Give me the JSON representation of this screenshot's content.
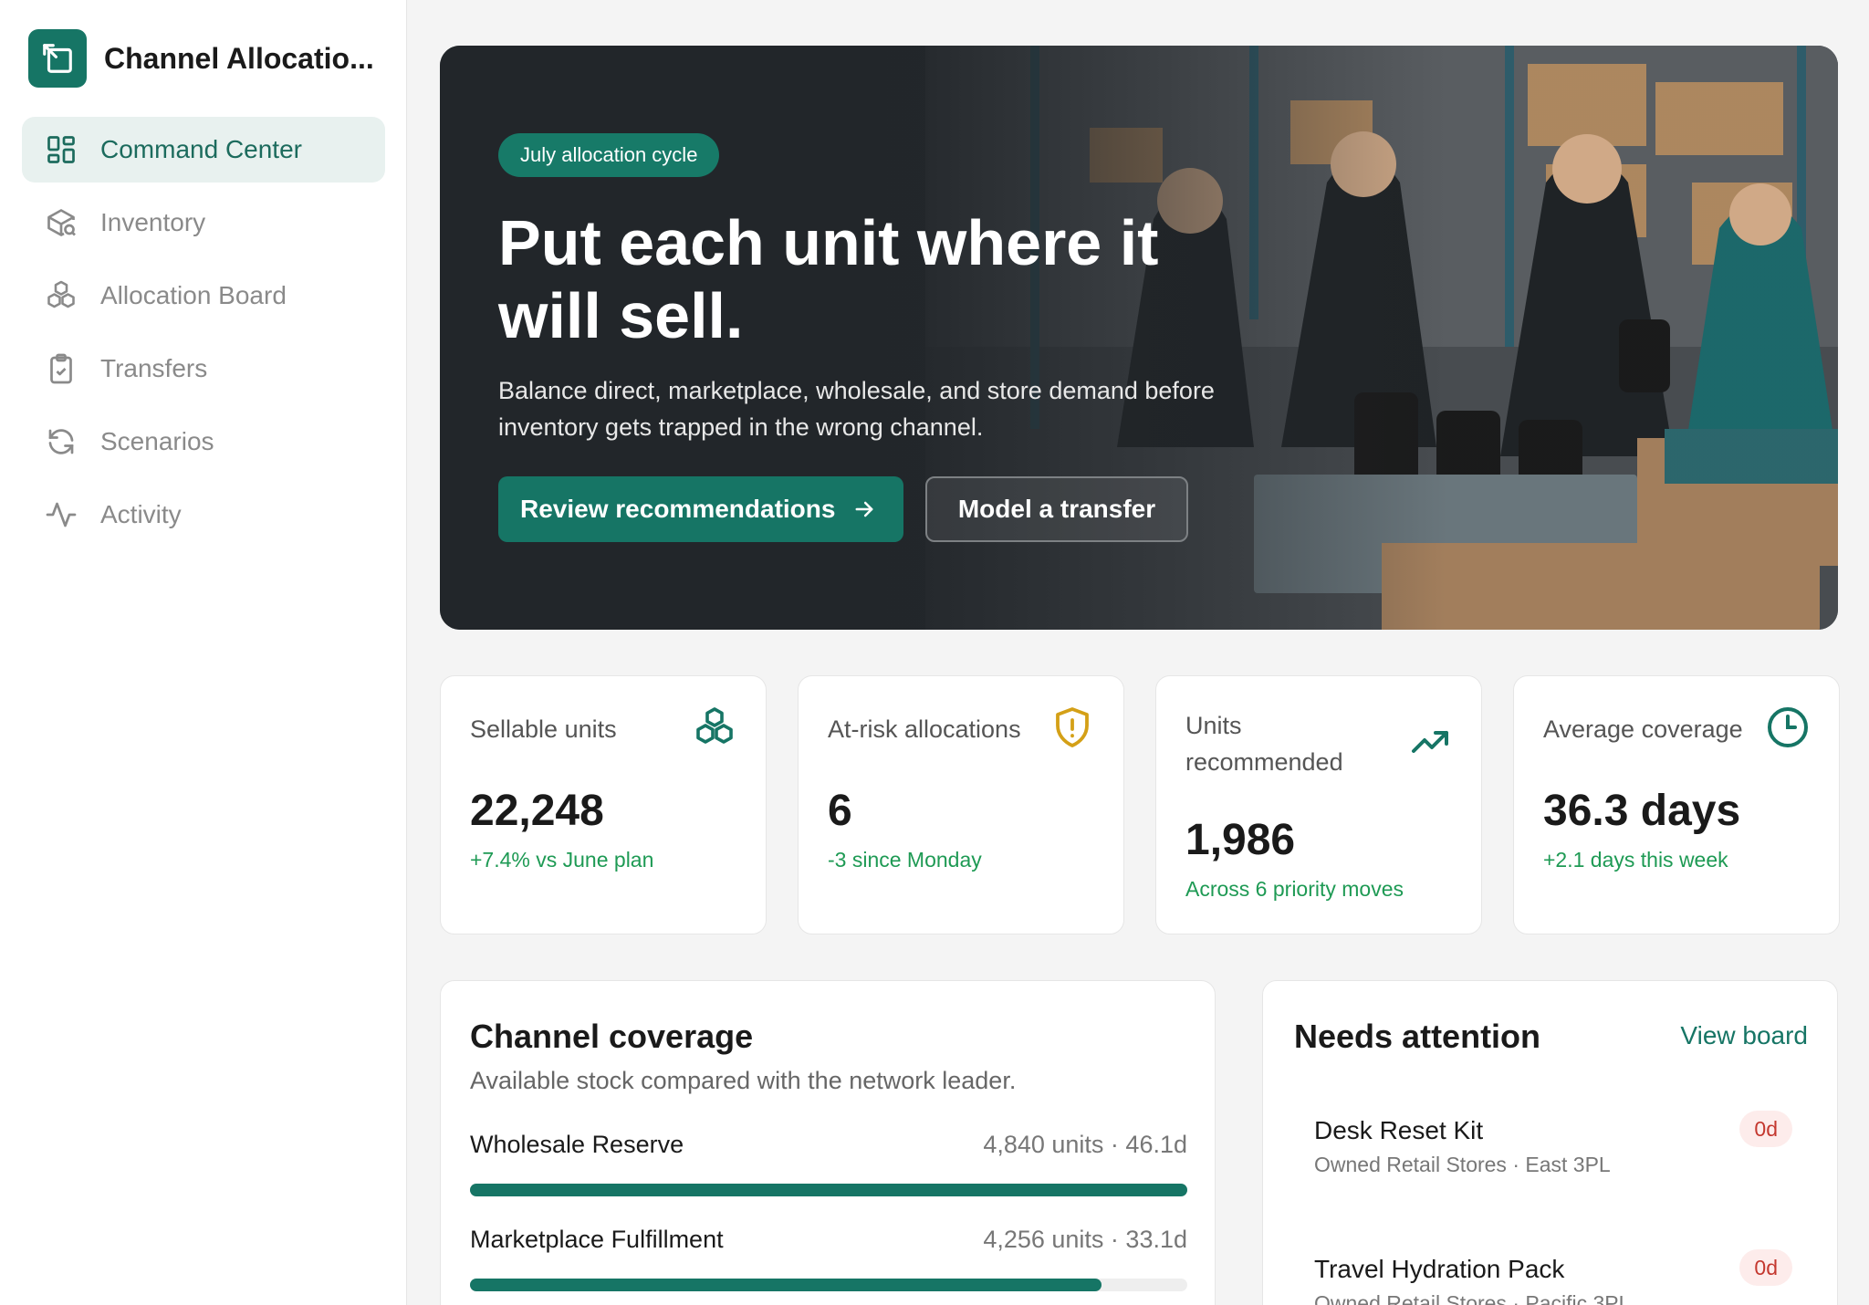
{
  "app": {
    "title": "Channel Allocatio..."
  },
  "sidebar": {
    "items": [
      {
        "label": "Command Center",
        "icon": "grid-icon",
        "active": true
      },
      {
        "label": "Inventory",
        "icon": "package-search-icon"
      },
      {
        "label": "Allocation Board",
        "icon": "boxes-icon"
      },
      {
        "label": "Transfers",
        "icon": "clipboard-check-icon"
      },
      {
        "label": "Scenarios",
        "icon": "refresh-icon"
      },
      {
        "label": "Activity",
        "icon": "activity-icon"
      }
    ]
  },
  "hero": {
    "badge": "July allocation cycle",
    "title": "Put each unit where it will sell.",
    "subtitle": "Balance direct, marketplace, wholesale, and store demand before inventory gets trapped in the wrong channel.",
    "primary_button": "Review recommendations",
    "secondary_button": "Model a transfer"
  },
  "stats": [
    {
      "label": "Sellable units",
      "value": "22,248",
      "delta": "+7.4% vs June plan",
      "icon": "boxes-icon"
    },
    {
      "label": "At-risk allocations",
      "value": "6",
      "delta": "-3 since Monday",
      "icon": "shield-alert-icon"
    },
    {
      "label": "Units recommended",
      "value": "1,986",
      "delta": "Across 6 priority moves",
      "icon": "trending-up-icon"
    },
    {
      "label": "Average coverage",
      "value": "36.3 days",
      "delta": "+2.1 days this week",
      "icon": "clock-icon"
    }
  ],
  "coverage": {
    "title": "Channel coverage",
    "subtitle": "Available stock compared with the network leader.",
    "rows": [
      {
        "name": "Wholesale Reserve",
        "meta": "4,840 units · 46.1d",
        "fraction": 1.0
      },
      {
        "name": "Marketplace Fulfillment",
        "meta": "4,256 units · 33.1d",
        "fraction": 0.88
      }
    ]
  },
  "attention": {
    "title": "Needs attention",
    "link": "View board",
    "items": [
      {
        "name": "Desk Reset Kit",
        "meta": "Owned Retail Stores · East 3PL",
        "badge": "0d"
      },
      {
        "name": "Travel Hydration Pack",
        "meta": "Owned Retail Stores · Pacific 3PL",
        "badge": "0d"
      }
    ]
  },
  "colors": {
    "accent": "#167565",
    "positive": "#1e9a54",
    "warning": "#d4a017",
    "danger": "#c4382f"
  }
}
